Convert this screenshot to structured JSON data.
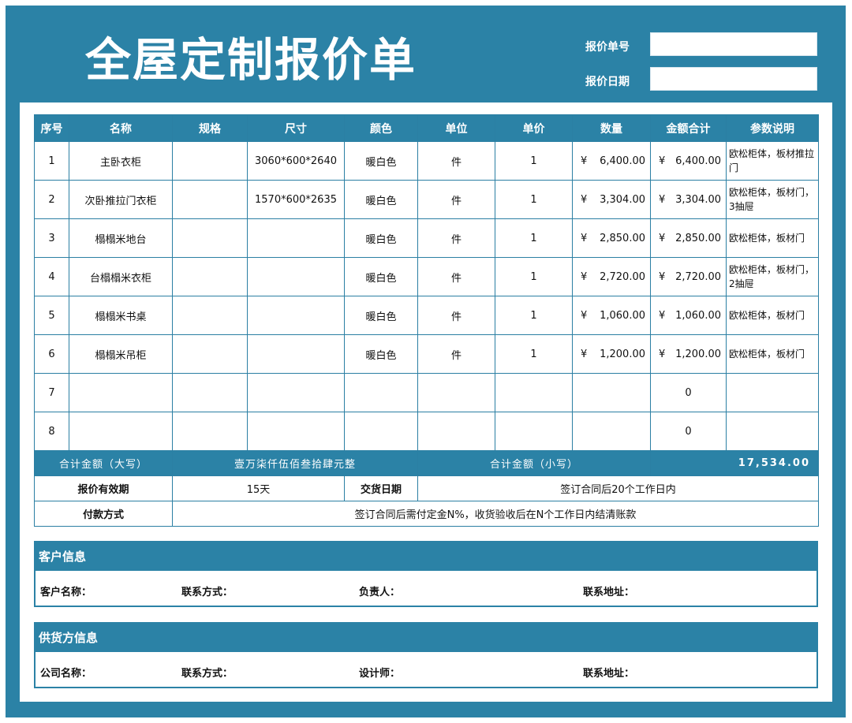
{
  "header": {
    "title": "全屋定制报价单",
    "quote_no_label": "报价单号",
    "quote_no_value": "",
    "quote_date_label": "报价日期",
    "quote_date_value": ""
  },
  "columns": [
    "序号",
    "名称",
    "规格",
    "尺寸",
    "颜色",
    "单位",
    "单价",
    "数量",
    "金额合计",
    "参数说明"
  ],
  "rows": [
    {
      "no": "1",
      "name": "主卧衣柜",
      "spec": "",
      "size": "3060*600*2640",
      "color": "暖白色",
      "unit": "件",
      "price": "1",
      "qty_sym": "¥",
      "qty": "6,400.00",
      "amt_sym": "¥",
      "amt": "6,400.00",
      "desc": "欧松柜体，板材推拉门"
    },
    {
      "no": "2",
      "name": "次卧推拉门衣柜",
      "spec": "",
      "size": "1570*600*2635",
      "color": "暖白色",
      "unit": "件",
      "price": "1",
      "qty_sym": "¥",
      "qty": "3,304.00",
      "amt_sym": "¥",
      "amt": "3,304.00",
      "desc": "欧松柜体，板材门，3抽屉"
    },
    {
      "no": "3",
      "name": "榻榻米地台",
      "spec": "",
      "size": "",
      "color": "暖白色",
      "unit": "件",
      "price": "1",
      "qty_sym": "¥",
      "qty": "2,850.00",
      "amt_sym": "¥",
      "amt": "2,850.00",
      "desc": "欧松柜体，板材门"
    },
    {
      "no": "4",
      "name": "台榻榻米衣柜",
      "spec": "",
      "size": "",
      "color": "暖白色",
      "unit": "件",
      "price": "1",
      "qty_sym": "¥",
      "qty": "2,720.00",
      "amt_sym": "¥",
      "amt": "2,720.00",
      "desc": "欧松柜体，板材门，2抽屉"
    },
    {
      "no": "5",
      "name": "榻榻米书桌",
      "spec": "",
      "size": "",
      "color": "暖白色",
      "unit": "件",
      "price": "1",
      "qty_sym": "¥",
      "qty": "1,060.00",
      "amt_sym": "¥",
      "amt": "1,060.00",
      "desc": "欧松柜体，板材门"
    },
    {
      "no": "6",
      "name": "榻榻米吊柜",
      "spec": "",
      "size": "",
      "color": "暖白色",
      "unit": "件",
      "price": "1",
      "qty_sym": "¥",
      "qty": "1,200.00",
      "amt_sym": "¥",
      "amt": "1,200.00",
      "desc": "欧松柜体，板材门"
    },
    {
      "no": "7",
      "name": "",
      "spec": "",
      "size": "",
      "color": "",
      "unit": "",
      "price": "",
      "qty_sym": "",
      "qty": "",
      "amt_sym": "",
      "amt": "0",
      "desc": ""
    },
    {
      "no": "8",
      "name": "",
      "spec": "",
      "size": "",
      "color": "",
      "unit": "",
      "price": "",
      "qty_sym": "",
      "qty": "",
      "amt_sym": "",
      "amt": "0",
      "desc": ""
    }
  ],
  "totals": {
    "upper_label": "合计金额（大写）",
    "upper_value": "壹万柒仟伍佰叁拾肆元整",
    "lower_label": "合计金额（小写）",
    "lower_value": "17,534.00"
  },
  "terms": {
    "validity_label": "报价有效期",
    "validity_value": "15天",
    "delivery_label": "交货日期",
    "delivery_value": "签订合同后20个工作日内",
    "payment_label": "付款方式",
    "payment_value": "签订合同后需付定金N%，收货验收后在N个工作日内结清账款"
  },
  "customer": {
    "heading": "客户信息",
    "name_label": "客户名称：",
    "contact_label": "联系方式：",
    "owner_label": "负责人：",
    "address_label": "联系地址："
  },
  "supplier": {
    "heading": "供货方信息",
    "company_label": "公司名称：",
    "contact_label": "联系方式：",
    "designer_label": "设计师：",
    "address_label": "联系地址："
  },
  "colors": {
    "primary": "#2b82a6",
    "background": "#ffffff"
  }
}
